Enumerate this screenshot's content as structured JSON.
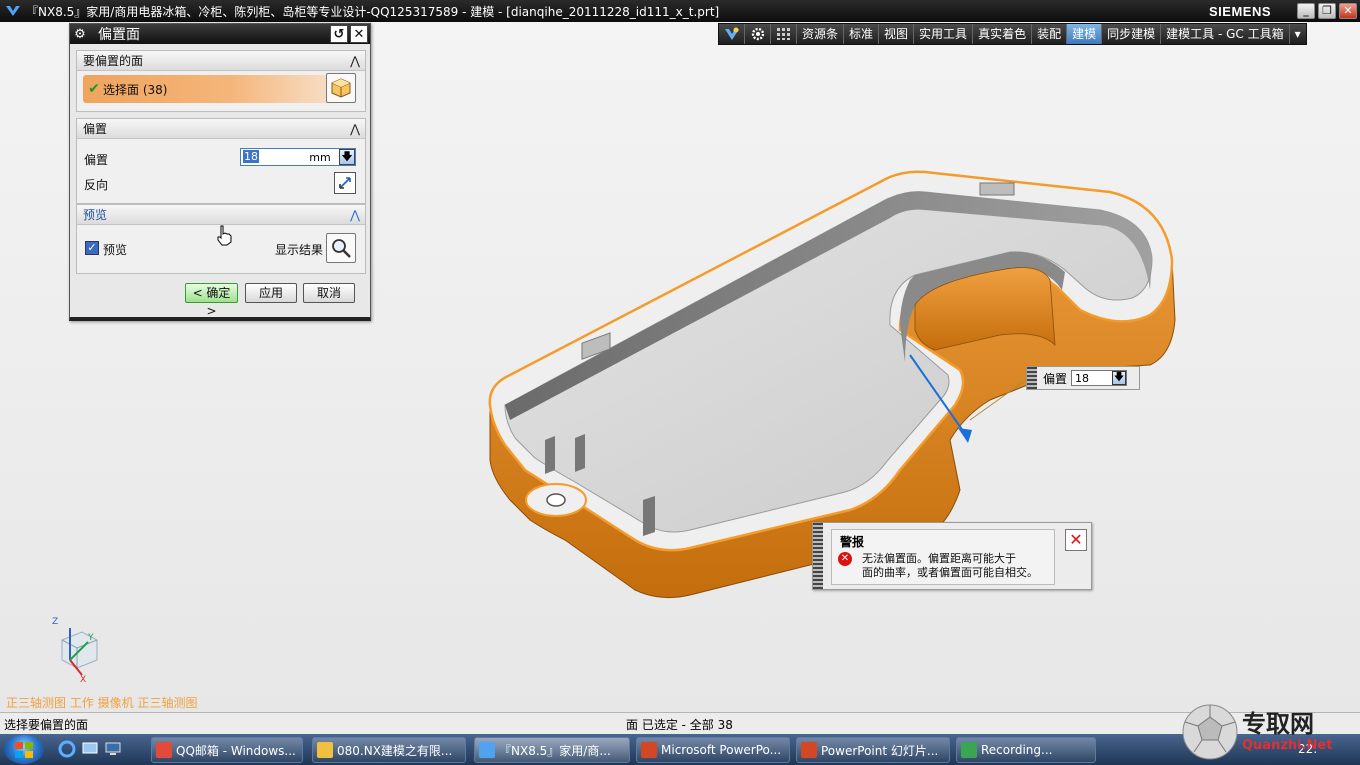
{
  "window": {
    "title": "『NX8.5』家用/商用电器冰箱、冷柜、陈列柜、岛柜等专业设计-QQ125317589 - 建模 - [dianqihe_20111228_id111_x_t.prt]",
    "brand": "SIEMENS",
    "min": "_",
    "max": "❐",
    "close": "✕"
  },
  "ribbon": {
    "tabs": [
      "资源条",
      "标准",
      "视图",
      "实用工具",
      "真实着色",
      "装配",
      "建模",
      "同步建模",
      "建模工具 - GC 工具箱"
    ],
    "active_index": 6,
    "more": "▾"
  },
  "dialog": {
    "title": "偏置面",
    "group_faces": {
      "title": "要偏置的面",
      "select_label": "选择面 (38)"
    },
    "group_offset": {
      "title": "偏置",
      "offset_label": "偏置",
      "offset_value": "18",
      "unit": "mm",
      "reverse_label": "反向"
    },
    "group_preview": {
      "title": "预览",
      "preview_label": "预览",
      "show_result_label": "显示结果"
    },
    "buttons": {
      "ok": "< 确定 >",
      "apply": "应用",
      "cancel": "取消"
    }
  },
  "float_offset": {
    "label": "偏置",
    "value": "18"
  },
  "alert": {
    "title": "警报",
    "line1": "无法偏置面。偏置距离可能大于",
    "line2": "面的曲率，或者偏置面可能自相交。"
  },
  "view_label": "正三轴测图 工作 摄像机 正三轴测图",
  "triad": {
    "x": "X",
    "y": "Y",
    "z": "Z"
  },
  "status": {
    "prompt": "选择要偏置的面",
    "selection": "面 已选定 - 全部 38"
  },
  "taskbar": {
    "items": [
      "QQ邮箱 - Windows...",
      "080.NX建模之有限...",
      "『NX8.5』家用/商...",
      "Microsoft PowerPo...",
      "PowerPoint 幻灯片...",
      "Recording..."
    ],
    "clock": "22:"
  },
  "watermark": {
    "text": "专取网",
    "url": "Quanzhi.Net"
  },
  "colors": {
    "accent_orange": "#e8901e",
    "ribbon_active": "#3d79bb",
    "error_red": "#d11111"
  }
}
